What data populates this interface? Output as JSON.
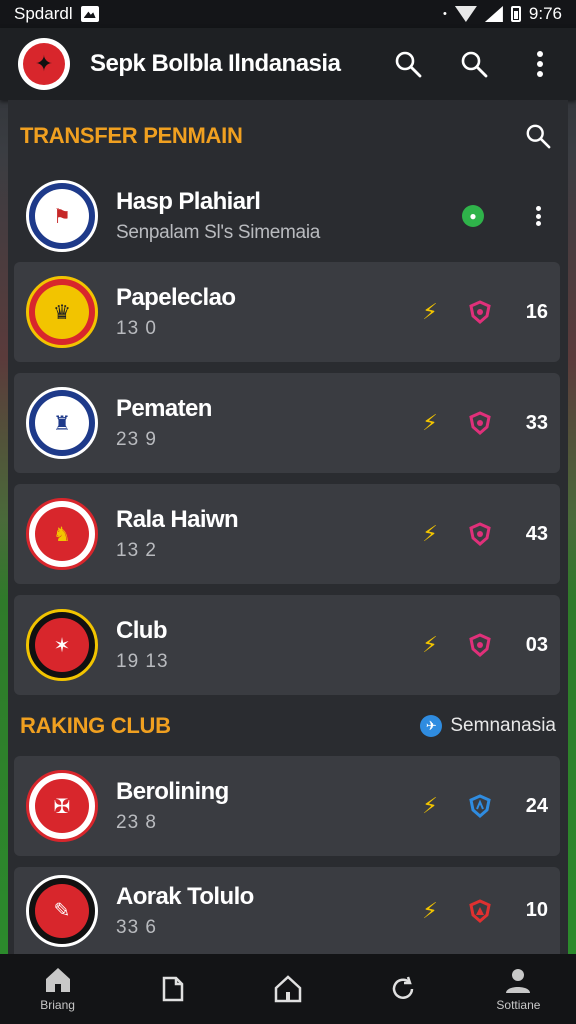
{
  "status": {
    "carrier": "Spdardl",
    "time": "9:76"
  },
  "app": {
    "title": "Sepk Bolbla Ilndanasia"
  },
  "transfer": {
    "header": "TRANSFER PENMAIN",
    "top": {
      "name": "Hasp Plahiarl",
      "sub": "Senpalam Sl's Simemaia"
    },
    "items": [
      {
        "name": "Papeleclao",
        "sub": "13 0",
        "count": "16"
      },
      {
        "name": "Pematen",
        "sub": "23 9",
        "count": "33"
      },
      {
        "name": "Rala Haiwn",
        "sub": "13 2",
        "count": "43"
      },
      {
        "name": "Club",
        "sub": "19 13",
        "count": "03"
      }
    ]
  },
  "ranking": {
    "header": "RAKING CLUB",
    "filter_label": "Semnanasia",
    "items": [
      {
        "name": "Berolining",
        "sub": "23 8",
        "count": "24"
      },
      {
        "name": "Aorak Tolulo",
        "sub": "33 6",
        "count": "10"
      }
    ]
  },
  "nav": {
    "home_label": "Briang",
    "profile_label": "Sottiane"
  },
  "colors": {
    "accent": "#f0a020",
    "bolt": "#f2c400",
    "shield_pink": "#e0307a",
    "shield_blue": "#2f8ce0",
    "shield_red": "#e03030",
    "green": "#2fb34a"
  }
}
